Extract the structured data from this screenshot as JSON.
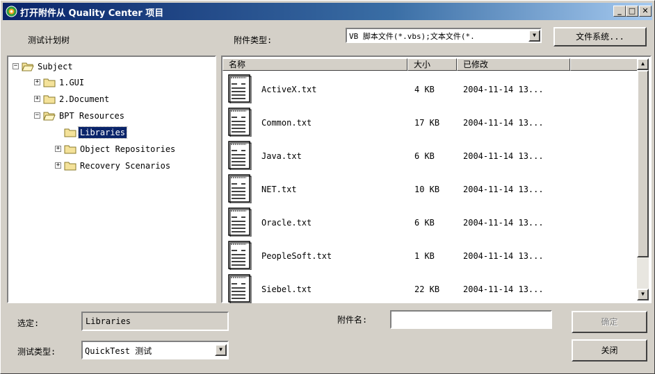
{
  "window": {
    "title": "打开附件从 Quality Center 项目",
    "min_label": "_",
    "max_label": "□",
    "close_label": "✕"
  },
  "left_panel": {
    "header": "测试计划树",
    "tree": [
      {
        "label": "Subject",
        "toggle": "−",
        "expanded": true
      },
      {
        "label": "1.GUI",
        "toggle": "+"
      },
      {
        "label": "2.Document",
        "toggle": "+"
      },
      {
        "label": "BPT Resources",
        "toggle": "−",
        "expanded": true
      },
      {
        "label": "Libraries",
        "toggle": "",
        "selected": true
      },
      {
        "label": "Object Repositories",
        "toggle": "+"
      },
      {
        "label": "Recovery Scenarios",
        "toggle": "+"
      }
    ]
  },
  "attachment_type": {
    "label": "附件类型:",
    "value": "VB 脚本文件(*.vbs);文本文件(*.",
    "dropdown_icon": "▼"
  },
  "file_system_button": "文件系统...",
  "file_list": {
    "columns": [
      "名称",
      "大小",
      "已修改"
    ],
    "rows": [
      {
        "name": "ActiveX.txt",
        "size": "4 KB",
        "modified": "2004-11-14 13..."
      },
      {
        "name": "Common.txt",
        "size": "17 KB",
        "modified": "2004-11-14 13..."
      },
      {
        "name": "Java.txt",
        "size": "6 KB",
        "modified": "2004-11-14 13..."
      },
      {
        "name": "NET.txt",
        "size": "10 KB",
        "modified": "2004-11-14 13..."
      },
      {
        "name": "Oracle.txt",
        "size": "6 KB",
        "modified": "2004-11-14 13..."
      },
      {
        "name": "PeopleSoft.txt",
        "size": "1 KB",
        "modified": "2004-11-14 13..."
      },
      {
        "name": "Siebel.txt",
        "size": "22 KB",
        "modified": "2004-11-14 13..."
      }
    ],
    "scroll_up": "▲",
    "scroll_down": "▼"
  },
  "selected": {
    "label": "选定:",
    "value": "Libraries"
  },
  "attachment_name": {
    "label": "附件名:",
    "value": ""
  },
  "test_type": {
    "label": "测试类型:",
    "value": "QuickTest 测试",
    "dropdown_icon": "▼"
  },
  "buttons": {
    "ok": "确定",
    "close": "关闭"
  },
  "colors": {
    "title_start": "#0a246a",
    "title_end": "#a6caf0",
    "selection": "#0a246a",
    "face": "#d4d0c8"
  }
}
